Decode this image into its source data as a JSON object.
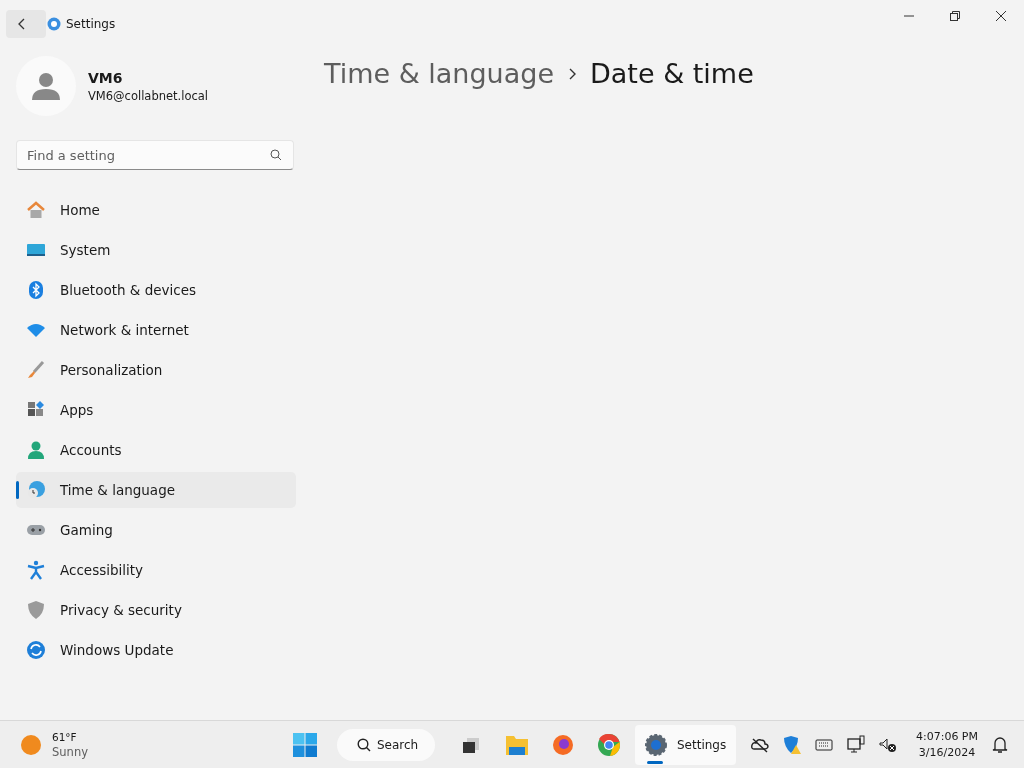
{
  "window": {
    "title": "Settings"
  },
  "user": {
    "name": "VM6",
    "email": "VM6@collabnet.local"
  },
  "search": {
    "placeholder": "Find a setting"
  },
  "nav": [
    {
      "label": "Home",
      "selected": false
    },
    {
      "label": "System",
      "selected": false
    },
    {
      "label": "Bluetooth & devices",
      "selected": false
    },
    {
      "label": "Network & internet",
      "selected": false
    },
    {
      "label": "Personalization",
      "selected": false
    },
    {
      "label": "Apps",
      "selected": false
    },
    {
      "label": "Accounts",
      "selected": false
    },
    {
      "label": "Time & language",
      "selected": true
    },
    {
      "label": "Gaming",
      "selected": false
    },
    {
      "label": "Accessibility",
      "selected": false
    },
    {
      "label": "Privacy & security",
      "selected": false
    },
    {
      "label": "Windows Update",
      "selected": false
    }
  ],
  "breadcrumb": {
    "parent": "Time & language",
    "current": "Date & time"
  },
  "taskbar": {
    "weather": {
      "temperature": "61°F",
      "condition": "Sunny"
    },
    "search": {
      "label": "Search"
    },
    "settings_app": {
      "label": "Settings",
      "selected": true
    },
    "clock": {
      "time": "4:07:06 PM",
      "date": "3/16/2024"
    }
  }
}
